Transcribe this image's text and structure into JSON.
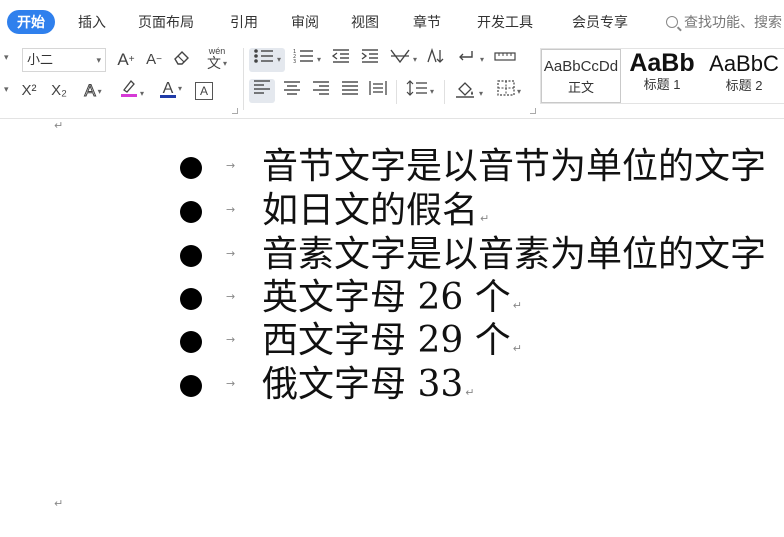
{
  "menubar": {
    "tabs": [
      {
        "label": "开始",
        "active": true
      },
      {
        "label": "插入"
      },
      {
        "label": "页面布局"
      },
      {
        "label": "引用"
      },
      {
        "label": "审阅"
      },
      {
        "label": "视图"
      },
      {
        "label": "章节"
      },
      {
        "label": "开发工具"
      },
      {
        "label": "会员专享"
      }
    ],
    "search_label": "查找功能、搜索"
  },
  "ribbon": {
    "font_size_value": "小二",
    "pinyin_guide_label": "wén",
    "pinyin_guide_char": "文",
    "superscript_label": "X²",
    "subscript_label": "X₂",
    "text_effect_label": "A",
    "font_color_label": "A",
    "char_border_label": "A",
    "grow_font_label": "A",
    "shrink_font_label": "A",
    "styles": [
      {
        "sample": "AaBbCcDd",
        "name": "正文"
      },
      {
        "sample": "AaBb",
        "name": "标题 1"
      },
      {
        "sample": "AaBbC",
        "name": "标题 2"
      }
    ],
    "colors": {
      "accent": "#2f80ed",
      "highlight": "#d63ad6",
      "font_color": "#1f3ba8"
    }
  },
  "document": {
    "bullets": [
      {
        "text": "音节文字是以音节为单位的文字",
        "mark": ""
      },
      {
        "text": "如日文的假名",
        "mark": "↵"
      },
      {
        "text": "音素文字是以音素为单位的文字",
        "mark": ""
      },
      {
        "text": "英文字母 26 个",
        "mark": "↵"
      },
      {
        "text": "西文字母 29 个",
        "mark": "↵"
      },
      {
        "text": "俄文字母 33",
        "mark": "↵"
      }
    ],
    "tab_mark": "→",
    "paragraph_mark": "↵"
  }
}
